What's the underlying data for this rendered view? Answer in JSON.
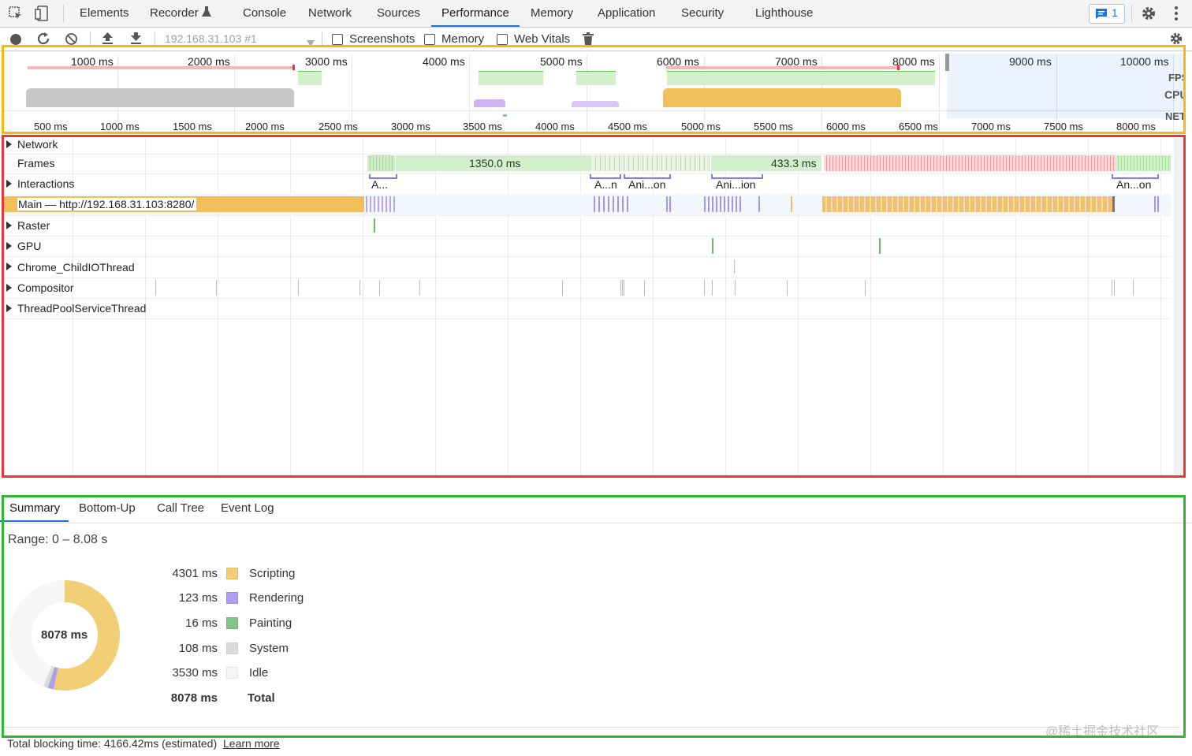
{
  "tabs": [
    {
      "label": "Elements"
    },
    {
      "label": "Recorder"
    },
    {
      "label": "Console"
    },
    {
      "label": "Network"
    },
    {
      "label": "Sources"
    },
    {
      "label": "Performance"
    },
    {
      "label": "Memory"
    },
    {
      "label": "Application"
    },
    {
      "label": "Security"
    },
    {
      "label": "Lighthouse"
    }
  ],
  "active_tab": "Performance",
  "issues_badge": "1",
  "toolbar": {
    "recording_select": "192.168.31.103 #1",
    "screenshots_label": "Screenshots",
    "memory_label": "Memory",
    "webvitals_label": "Web Vitals",
    "screenshots_checked": false,
    "memory_checked": false,
    "webvitals_checked": false
  },
  "overview": {
    "top_ticks": [
      "1000 ms",
      "2000 ms",
      "3000 ms",
      "4000 ms",
      "5000 ms",
      "6000 ms",
      "7000 ms",
      "8000 ms",
      "9000 ms",
      "10000 ms"
    ],
    "bottom_ticks": [
      "500 ms",
      "1000 ms",
      "1500 ms",
      "2000 ms",
      "2500 ms",
      "3000 ms",
      "3500 ms",
      "4000 ms",
      "4500 ms",
      "5000 ms",
      "5500 ms",
      "6000 ms",
      "6500 ms",
      "7000 ms",
      "7500 ms",
      "8000 ms"
    ],
    "labels": {
      "fps": "FPS",
      "cpu": "CPU",
      "net": "NET"
    }
  },
  "tracks": {
    "network": "Network",
    "frames": "Frames",
    "frames_values": [
      "1350.0 ms",
      "433.3 ms"
    ],
    "interactions": "Interactions",
    "interaction_labels": [
      "A...",
      "A...n",
      "Ani...on",
      "Ani...ion",
      "An...on"
    ],
    "main": "Main — http://192.168.31.103:8280/",
    "raster": "Raster",
    "gpu": "GPU",
    "childio": "Chrome_ChildIOThread",
    "compositor": "Compositor",
    "threadpool": "ThreadPoolServiceThread"
  },
  "bottom_tabs": [
    {
      "label": "Summary"
    },
    {
      "label": "Bottom-Up"
    },
    {
      "label": "Call Tree"
    },
    {
      "label": "Event Log"
    }
  ],
  "summary": {
    "range": "Range: 0 – 8.08 s",
    "donut_total": "8078 ms",
    "rows": [
      {
        "value": "4301 ms",
        "name": "Scripting",
        "color": "#f2cf76",
        "ms": 4301
      },
      {
        "value": "123 ms",
        "name": "Rendering",
        "color": "#af9cf4",
        "ms": 123
      },
      {
        "value": "16 ms",
        "name": "Painting",
        "color": "#84c485",
        "ms": 16
      },
      {
        "value": "108 ms",
        "name": "System",
        "color": "#dadada",
        "ms": 108
      },
      {
        "value": "3530 ms",
        "name": "Idle",
        "color": "#f6f6f6",
        "ms": 3530
      }
    ],
    "total_value": "8078 ms",
    "total_label": "Total"
  },
  "footer": {
    "text": "Total blocking time: 4166.42ms (estimated)",
    "link": "Learn more"
  },
  "watermark": "@稀土掘金技术社区"
}
